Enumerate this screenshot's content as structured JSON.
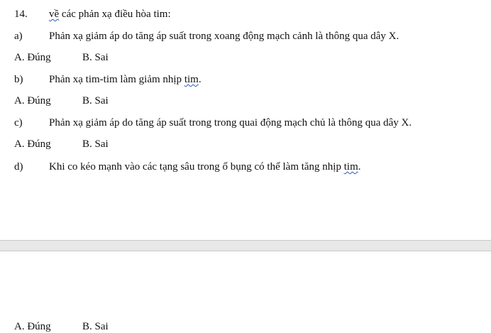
{
  "question": {
    "number": "14.",
    "stem_word": "về",
    "stem_rest": " các phản xạ điều hòa tim:"
  },
  "items": [
    {
      "label": "a)",
      "text": "Phản xạ giảm áp do tăng áp suất trong xoang động mạch cảnh là thông qua dây X.",
      "pre": "",
      "flag": "",
      "post": ""
    },
    {
      "label": "b)",
      "text": "",
      "pre": "Phản xạ tim-tim làm giảm nhịp ",
      "flag": "tim",
      "post": "."
    },
    {
      "label": "c)",
      "text": "Phản xạ giảm áp do tăng áp suất trong trong quai động mạch chủ là thông qua dây X.",
      "pre": "",
      "flag": "",
      "post": ""
    },
    {
      "label": "d)",
      "text": "",
      "pre": "Khi co kéo mạnh vào các tạng sâu trong ổ bụng có thể làm tăng nhịp ",
      "flag": "tim",
      "post": "."
    }
  ],
  "options": {
    "a": "A. Đúng",
    "b": "B. Sai"
  },
  "colors": {
    "page": "#ffffff",
    "page_gap": "#e8e8e8",
    "spell_underline": "#2b57c8"
  }
}
